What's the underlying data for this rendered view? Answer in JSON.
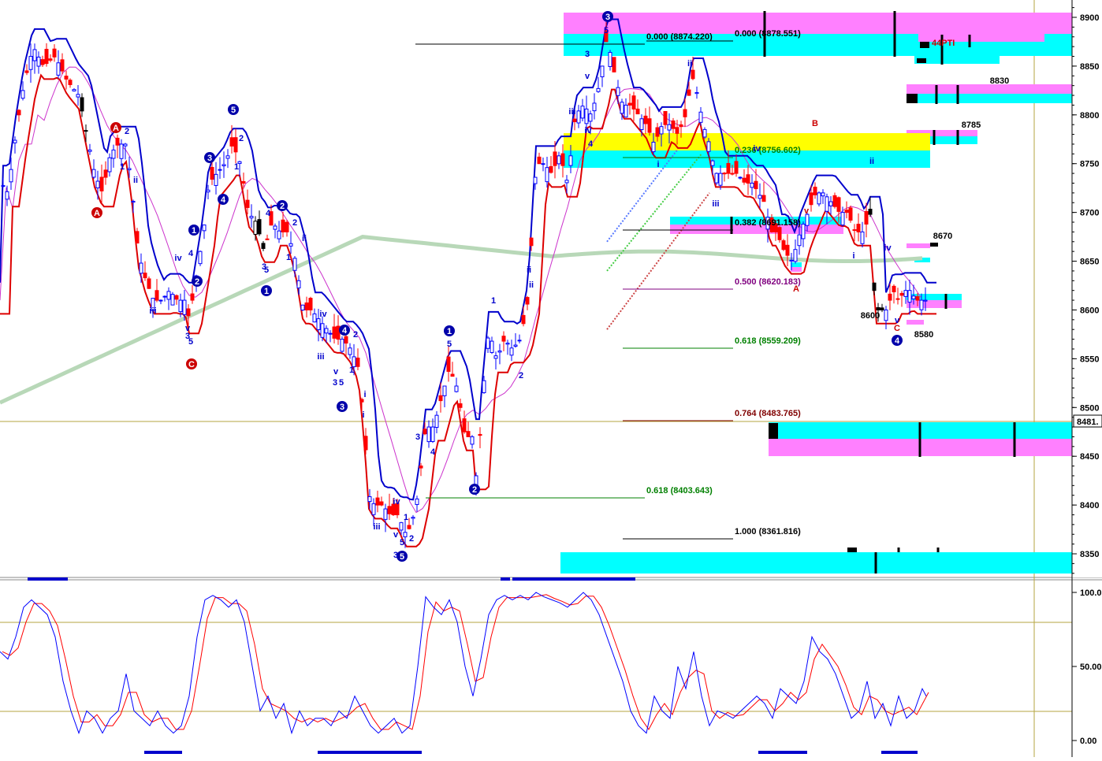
{
  "chart_data": {
    "type": "candlestick-with-indicators",
    "price_panel": {
      "y_ticks": [
        "8900",
        "8850",
        "8800",
        "8750",
        "8700",
        "8650",
        "8600",
        "8550",
        "8500",
        "8450",
        "8400",
        "8350"
      ],
      "ylim": [
        8320,
        8910
      ],
      "current_price_tag": "8481.",
      "fib_levels": [
        {
          "label": "0.000 (8874.220)",
          "value": 8874.22,
          "color": "#000000"
        },
        {
          "label": "0.000 (8878.551)",
          "value": 8878.551,
          "color": "#000000"
        },
        {
          "label": "0.236 (8756.602)",
          "value": 8756.602,
          "color": "#008000"
        },
        {
          "label": "0.382 (8691.158)",
          "value": 8691.158,
          "color": "#000000"
        },
        {
          "label": "0.500 (8620.183)",
          "value": 8620.183,
          "color": "#800080"
        },
        {
          "label": "0.618 (8559.209)",
          "value": 8559.209,
          "color": "#008000"
        },
        {
          "label": "0.764 (8483.765)",
          "value": 8483.765,
          "color": "#800000"
        },
        {
          "label": "0.618 (8403.643)",
          "value": 8403.643,
          "color": "#008000"
        },
        {
          "label": "1.000 (8361.816)",
          "value": 8361.816,
          "color": "#000000"
        }
      ],
      "price_annotations": [
        "8830",
        "8785",
        "8670",
        "8600",
        "8580"
      ],
      "pti_label": "44PTI",
      "wave_labels": [
        "1",
        "2",
        "3",
        "4",
        "5",
        "i",
        "ii",
        "iii",
        "iv",
        "v",
        "A",
        "B",
        "C"
      ]
    },
    "oscillator_panel": {
      "y_ticks": [
        "100.0",
        "50.00",
        "0.00"
      ],
      "ylim": [
        0,
        100
      ],
      "levels": [
        80,
        20
      ]
    },
    "colors": {
      "price_up": "#0000ff",
      "price_down": "#ff0000",
      "neutral": "#000000",
      "band_upper": "#0000cc",
      "band_lower": "#dd0000",
      "ma_long": "#b8d8b8",
      "ma_mid": "#cc33cc",
      "zone_cyan": "#00ffff",
      "zone_magenta": "#ff80ff",
      "zone_yellow": "#ffff00",
      "osc_fast": "#0000ff",
      "osc_slow": "#ff0000"
    }
  }
}
